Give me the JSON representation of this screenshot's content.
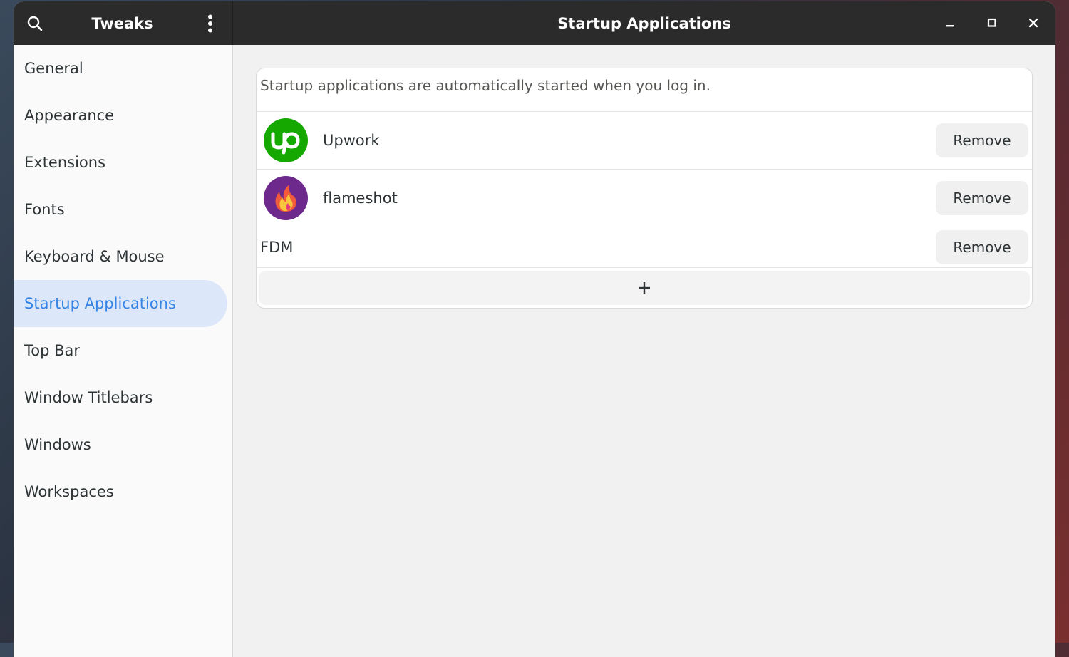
{
  "header": {
    "sidebar_title": "Tweaks",
    "title": "Startup Applications",
    "icons": {
      "search": "search-icon",
      "menu": "vertical-dots-icon",
      "minimize": "minimize-icon",
      "maximize": "maximize-icon",
      "close": "close-icon"
    }
  },
  "sidebar": {
    "items": [
      {
        "label": "General"
      },
      {
        "label": "Appearance"
      },
      {
        "label": "Extensions"
      },
      {
        "label": "Fonts"
      },
      {
        "label": "Keyboard & Mouse"
      },
      {
        "label": "Startup Applications",
        "selected": true
      },
      {
        "label": "Top Bar"
      },
      {
        "label": "Window Titlebars"
      },
      {
        "label": "Windows"
      },
      {
        "label": "Workspaces"
      }
    ]
  },
  "main": {
    "description": "Startup applications are automatically started when you log in.",
    "apps": [
      {
        "name": "Upwork",
        "icon": "upwork-icon",
        "remove_label": "Remove"
      },
      {
        "name": "flameshot",
        "icon": "flameshot-icon",
        "remove_label": "Remove"
      },
      {
        "name": "FDM",
        "icon": null,
        "remove_label": "Remove"
      }
    ],
    "add_label": "+"
  },
  "colors": {
    "accent": "#3584e4",
    "selected_bg": "#dce8f9",
    "headerbar": "#2b2b2b",
    "upwork_green": "#14a800",
    "flameshot_purple": "#6d2a8c"
  }
}
